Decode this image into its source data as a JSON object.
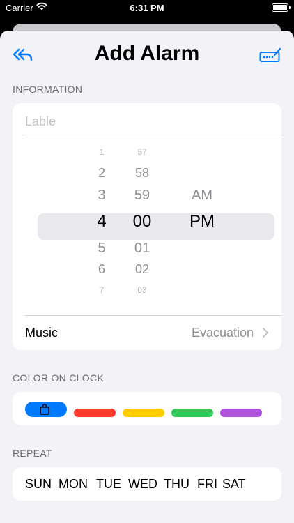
{
  "status_bar": {
    "carrier": "Carrier",
    "time": "6:31 PM"
  },
  "nav": {
    "title": "Add Alarm",
    "back_icon": "double-back-arrow-icon",
    "edit_icon": "keyboard-edit-icon"
  },
  "information": {
    "section_label": "INFORMATION",
    "label_placeholder": "Lable",
    "label_value": "",
    "time_picker": {
      "hours": [
        "1",
        "2",
        "3",
        "4",
        "5",
        "6",
        "7"
      ],
      "minutes": [
        "57",
        "58",
        "59",
        "00",
        "01",
        "02",
        "03"
      ],
      "periods": [
        "AM",
        "PM"
      ],
      "selected_hour": "4",
      "selected_minute": "00",
      "selected_period": "PM"
    },
    "music": {
      "label": "Music",
      "value": "Evacuation"
    }
  },
  "color_on_clock": {
    "section_label": "COLOR ON CLOCK",
    "colors": [
      "#007aff",
      "#ff3b30",
      "#ffcc00",
      "#34c759",
      "#af52de"
    ],
    "selected_index": 0,
    "selected_icon": "bag-icon"
  },
  "repeat": {
    "section_label": "REPEAT",
    "days": [
      "SUN",
      "MON",
      "TUE",
      "WED",
      "THU",
      "FRI",
      "SAT"
    ]
  },
  "accent_color": "#007aff"
}
